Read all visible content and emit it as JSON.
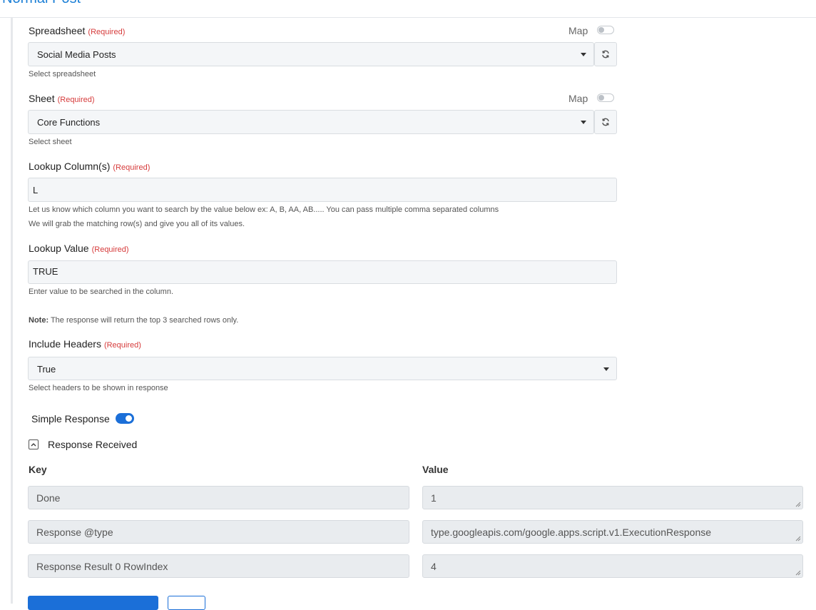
{
  "page": {
    "title": "Normal Post"
  },
  "spreadsheet": {
    "label": "Spreadsheet",
    "required": "(Required)",
    "map_label": "Map",
    "value": "Social Media Posts",
    "help": "Select spreadsheet"
  },
  "sheet": {
    "label": "Sheet",
    "required": "(Required)",
    "map_label": "Map",
    "value": "Core Functions",
    "help": "Select sheet"
  },
  "lookup_columns": {
    "label": "Lookup Column(s)",
    "required": "(Required)",
    "value": "L",
    "help_line1": "Let us know which column you want to search by the value below ex: A, B, AA, AB..... You can pass multiple comma separated columns",
    "help_line2": "We will grab the matching row(s) and give you all of its values."
  },
  "lookup_value": {
    "label": "Lookup Value",
    "required": "(Required)",
    "value": "TRUE",
    "help": "Enter value to be searched in the column."
  },
  "note": {
    "prefix": "Note:",
    "text": " The response will return the top 3 searched rows only."
  },
  "include_headers": {
    "label": "Include Headers",
    "required": "(Required)",
    "value": "True",
    "help": "Select headers to be shown in response"
  },
  "simple_response": {
    "label": "Simple Response",
    "enabled": true
  },
  "response": {
    "label": "Response Received",
    "key_header": "Key",
    "value_header": "Value",
    "rows": [
      {
        "key": "Done",
        "value": "1"
      },
      {
        "key": "Response @type",
        "value": "type.googleapis.com/google.apps.script.v1.ExecutionResponse"
      },
      {
        "key": "Response Result 0 RowIndex",
        "value": "4"
      }
    ]
  },
  "colors": {
    "accent": "#1b6fd8",
    "required": "#d63b3b",
    "title": "#1b7fd6"
  }
}
